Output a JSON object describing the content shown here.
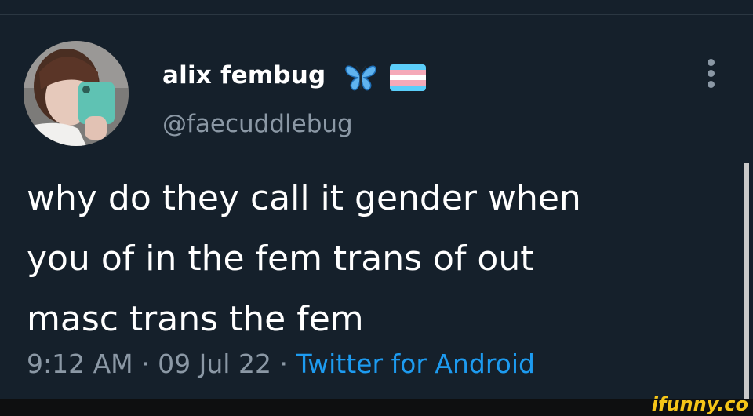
{
  "tweet": {
    "display_name": "alix fembug",
    "handle": "@faecuddlebug",
    "name_emojis": [
      "butterfly-icon",
      "transgender-flag-icon"
    ],
    "text_lines": [
      "why do they call it gender when",
      "you of in the fem trans of out",
      "masc trans the fem"
    ],
    "time": "9:12 AM",
    "separator": "·",
    "date": "09 Jul 22",
    "source": "Twitter for Android"
  },
  "watermark": "ifunny.co",
  "colors": {
    "background": "#15202b",
    "primary_text": "#ffffff",
    "secondary_text": "#8b98a5",
    "link": "#1d9bf0",
    "watermark": "#f5c518"
  }
}
